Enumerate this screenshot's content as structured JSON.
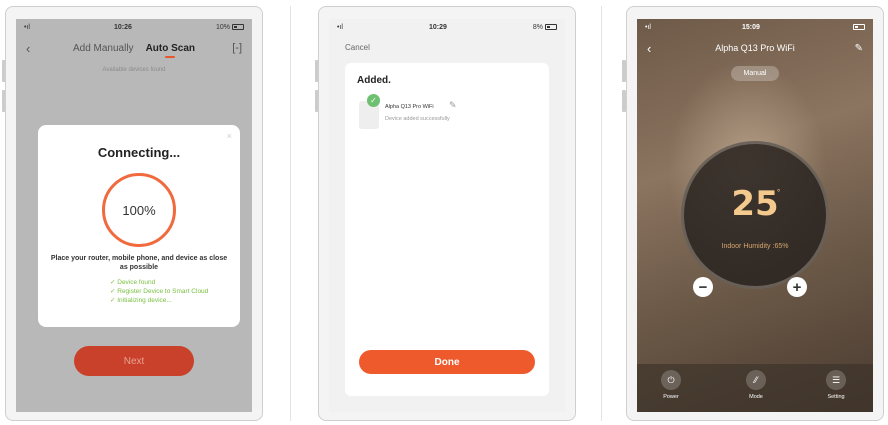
{
  "screen1": {
    "status": {
      "carrier": "•ıl",
      "time": "10:26",
      "battery": "10%"
    },
    "nav": {
      "back": "‹",
      "tab_manual": "Add Manually",
      "tab_auto": "Auto Scan",
      "scan_icon": "[-]"
    },
    "subtitle": "Available devices found",
    "dialog": {
      "close": "×",
      "title": "Connecting...",
      "progress": "100%",
      "message": "Place your router, mobile phone, and device as close as possible",
      "steps": [
        "✓ Device found",
        "✓ Register Device to Smart Cloud",
        "✓ Initializing device..."
      ]
    },
    "next_label": "Next"
  },
  "screen2": {
    "status": {
      "carrier": "•ıl",
      "time": "10:29",
      "battery": "8%"
    },
    "cancel": "Cancel",
    "added_title": "Added.",
    "device_name": "Alpha Q13 Pro WiFi",
    "device_status": "Device added successfully",
    "check": "✓",
    "edit": "✎",
    "done_label": "Done"
  },
  "screen3": {
    "status": {
      "carrier": "•ıl",
      "time": "15:09"
    },
    "nav": {
      "back": "‹",
      "title": "Alpha Q13 Pro WiFi",
      "edit": "✎"
    },
    "mode": "Manual",
    "temperature": "25",
    "unit": "°",
    "humidity": "Indoor Humidity :65%",
    "minus": "−",
    "plus": "+",
    "bottom": [
      {
        "label": "Power",
        "icon": "⏻"
      },
      {
        "label": "Mode",
        "icon": "⁄⁄"
      },
      {
        "label": "Setting",
        "icon": "☰"
      }
    ]
  }
}
